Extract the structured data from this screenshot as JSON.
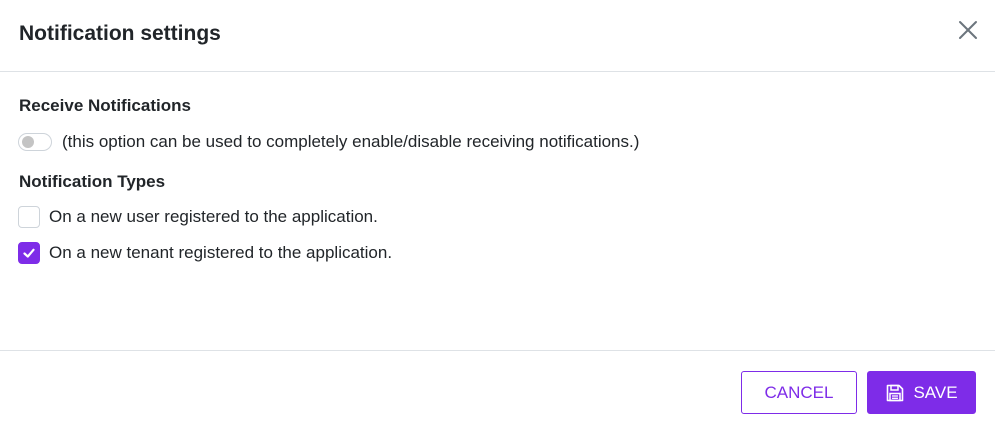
{
  "modal": {
    "title": "Notification settings"
  },
  "receive": {
    "heading": "Receive Notifications",
    "toggle_enabled": false,
    "toggle_description": "(this option can be used to completely enable/disable receiving notifications.)"
  },
  "types": {
    "heading": "Notification Types",
    "options": [
      {
        "label": "On a new user registered to the application.",
        "checked": false
      },
      {
        "label": "On a new tenant registered to the application.",
        "checked": true
      }
    ]
  },
  "footer": {
    "cancel_label": "CANCEL",
    "save_label": "SAVE"
  },
  "colors": {
    "accent": "#7e2ce8",
    "border": "#dee2e6",
    "text": "#212529"
  },
  "icons": {
    "close": "close-icon",
    "save": "floppy-disk-icon",
    "check": "checkmark-icon"
  }
}
